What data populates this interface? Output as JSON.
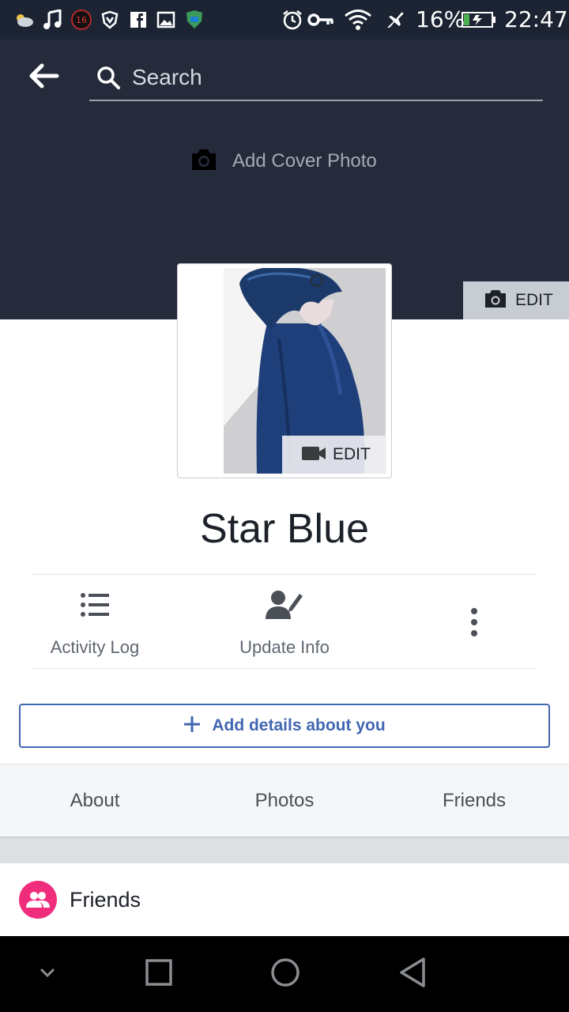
{
  "status_bar": {
    "notification_count": "16",
    "battery": "16%",
    "time": "22:47",
    "icons": [
      "weather-icon",
      "music-icon",
      "notification-badge-icon",
      "shield-icon",
      "facebook-icon",
      "gallery-icon",
      "vpn-icon",
      "alarm-icon",
      "key-icon",
      "wifi-icon",
      "airplane-icon",
      "battery-icon"
    ]
  },
  "header": {
    "search_placeholder": "Search",
    "add_cover_label": "Add Cover Photo",
    "cover_edit_label": "EDIT"
  },
  "profile": {
    "edit_label": "EDIT",
    "name": "Star Blue"
  },
  "actions": [
    {
      "label": "Activity Log",
      "icon": "list-icon"
    },
    {
      "label": "Update Info",
      "icon": "edit-person-icon"
    },
    {
      "label": "",
      "icon": "more-vertical-icon"
    }
  ],
  "add_details": {
    "label": "Add details about you"
  },
  "tabs": [
    {
      "label": "About"
    },
    {
      "label": "Photos"
    },
    {
      "label": "Friends"
    }
  ],
  "friends_section": {
    "title": "Friends"
  },
  "colors": {
    "cover_bg": "#252b3b",
    "accent": "#4267b2",
    "friends_badge": "#f02d7d"
  }
}
